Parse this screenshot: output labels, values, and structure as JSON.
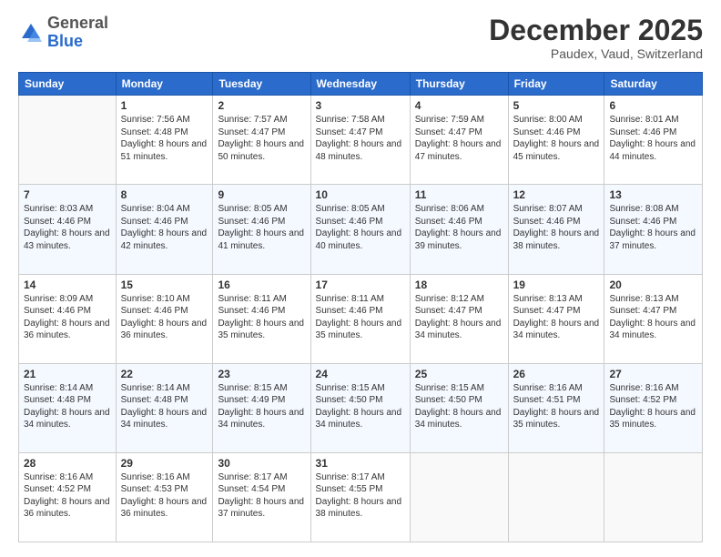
{
  "logo": {
    "general": "General",
    "blue": "Blue"
  },
  "header": {
    "month": "December 2025",
    "location": "Paudex, Vaud, Switzerland"
  },
  "weekdays": [
    "Sunday",
    "Monday",
    "Tuesday",
    "Wednesday",
    "Thursday",
    "Friday",
    "Saturday"
  ],
  "weeks": [
    [
      {
        "day": "",
        "empty": true
      },
      {
        "day": "1",
        "sunrise": "7:56 AM",
        "sunset": "4:48 PM",
        "daylight": "8 hours and 51 minutes."
      },
      {
        "day": "2",
        "sunrise": "7:57 AM",
        "sunset": "4:47 PM",
        "daylight": "8 hours and 50 minutes."
      },
      {
        "day": "3",
        "sunrise": "7:58 AM",
        "sunset": "4:47 PM",
        "daylight": "8 hours and 48 minutes."
      },
      {
        "day": "4",
        "sunrise": "7:59 AM",
        "sunset": "4:47 PM",
        "daylight": "8 hours and 47 minutes."
      },
      {
        "day": "5",
        "sunrise": "8:00 AM",
        "sunset": "4:46 PM",
        "daylight": "8 hours and 45 minutes."
      },
      {
        "day": "6",
        "sunrise": "8:01 AM",
        "sunset": "4:46 PM",
        "daylight": "8 hours and 44 minutes."
      }
    ],
    [
      {
        "day": "7",
        "sunrise": "8:03 AM",
        "sunset": "4:46 PM",
        "daylight": "8 hours and 43 minutes."
      },
      {
        "day": "8",
        "sunrise": "8:04 AM",
        "sunset": "4:46 PM",
        "daylight": "8 hours and 42 minutes."
      },
      {
        "day": "9",
        "sunrise": "8:05 AM",
        "sunset": "4:46 PM",
        "daylight": "8 hours and 41 minutes."
      },
      {
        "day": "10",
        "sunrise": "8:05 AM",
        "sunset": "4:46 PM",
        "daylight": "8 hours and 40 minutes."
      },
      {
        "day": "11",
        "sunrise": "8:06 AM",
        "sunset": "4:46 PM",
        "daylight": "8 hours and 39 minutes."
      },
      {
        "day": "12",
        "sunrise": "8:07 AM",
        "sunset": "4:46 PM",
        "daylight": "8 hours and 38 minutes."
      },
      {
        "day": "13",
        "sunrise": "8:08 AM",
        "sunset": "4:46 PM",
        "daylight": "8 hours and 37 minutes."
      }
    ],
    [
      {
        "day": "14",
        "sunrise": "8:09 AM",
        "sunset": "4:46 PM",
        "daylight": "8 hours and 36 minutes."
      },
      {
        "day": "15",
        "sunrise": "8:10 AM",
        "sunset": "4:46 PM",
        "daylight": "8 hours and 36 minutes."
      },
      {
        "day": "16",
        "sunrise": "8:11 AM",
        "sunset": "4:46 PM",
        "daylight": "8 hours and 35 minutes."
      },
      {
        "day": "17",
        "sunrise": "8:11 AM",
        "sunset": "4:46 PM",
        "daylight": "8 hours and 35 minutes."
      },
      {
        "day": "18",
        "sunrise": "8:12 AM",
        "sunset": "4:47 PM",
        "daylight": "8 hours and 34 minutes."
      },
      {
        "day": "19",
        "sunrise": "8:13 AM",
        "sunset": "4:47 PM",
        "daylight": "8 hours and 34 minutes."
      },
      {
        "day": "20",
        "sunrise": "8:13 AM",
        "sunset": "4:47 PM",
        "daylight": "8 hours and 34 minutes."
      }
    ],
    [
      {
        "day": "21",
        "sunrise": "8:14 AM",
        "sunset": "4:48 PM",
        "daylight": "8 hours and 34 minutes."
      },
      {
        "day": "22",
        "sunrise": "8:14 AM",
        "sunset": "4:48 PM",
        "daylight": "8 hours and 34 minutes."
      },
      {
        "day": "23",
        "sunrise": "8:15 AM",
        "sunset": "4:49 PM",
        "daylight": "8 hours and 34 minutes."
      },
      {
        "day": "24",
        "sunrise": "8:15 AM",
        "sunset": "4:50 PM",
        "daylight": "8 hours and 34 minutes."
      },
      {
        "day": "25",
        "sunrise": "8:15 AM",
        "sunset": "4:50 PM",
        "daylight": "8 hours and 34 minutes."
      },
      {
        "day": "26",
        "sunrise": "8:16 AM",
        "sunset": "4:51 PM",
        "daylight": "8 hours and 35 minutes."
      },
      {
        "day": "27",
        "sunrise": "8:16 AM",
        "sunset": "4:52 PM",
        "daylight": "8 hours and 35 minutes."
      }
    ],
    [
      {
        "day": "28",
        "sunrise": "8:16 AM",
        "sunset": "4:52 PM",
        "daylight": "8 hours and 36 minutes."
      },
      {
        "day": "29",
        "sunrise": "8:16 AM",
        "sunset": "4:53 PM",
        "daylight": "8 hours and 36 minutes."
      },
      {
        "day": "30",
        "sunrise": "8:17 AM",
        "sunset": "4:54 PM",
        "daylight": "8 hours and 37 minutes."
      },
      {
        "day": "31",
        "sunrise": "8:17 AM",
        "sunset": "4:55 PM",
        "daylight": "8 hours and 38 minutes."
      },
      {
        "day": "",
        "empty": true
      },
      {
        "day": "",
        "empty": true
      },
      {
        "day": "",
        "empty": true
      }
    ]
  ]
}
